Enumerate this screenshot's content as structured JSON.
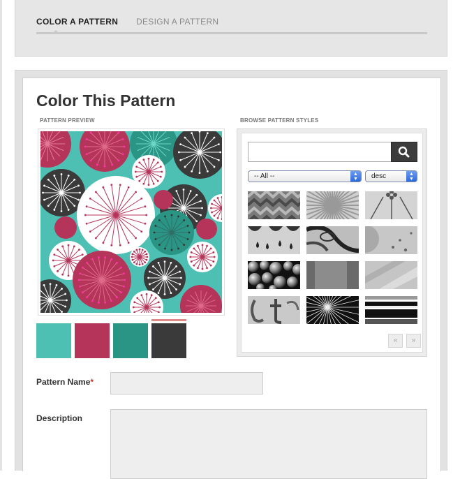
{
  "tabs": [
    {
      "label": "COLOR A PATTERN",
      "active": true
    },
    {
      "label": "DESIGN A PATTERN",
      "active": false
    }
  ],
  "page": {
    "title": "Color This Pattern"
  },
  "preview": {
    "label": "PATTERN PREVIEW"
  },
  "palette": {
    "swatches": [
      "#4dbfb3",
      "#b5345a",
      "#2a9585",
      "#3a3a3a"
    ],
    "selected_index": 3
  },
  "browse": {
    "label": "BROWSE PATTERN STYLES",
    "search": {
      "value": "",
      "icon": "search-icon"
    },
    "filter": {
      "selected": "-- All --"
    },
    "sort": {
      "selected": "desc"
    },
    "thumbnails": [
      "zigzag-pattern",
      "sunburst-pattern",
      "flower-pattern",
      "drops-pattern",
      "swirl-pattern",
      "dots-pattern",
      "bubbles-pattern",
      "blocks-pattern",
      "stripes-pattern",
      "letters-pattern",
      "starburst-pattern",
      "bands-pattern"
    ],
    "pager": {
      "prev": "«",
      "next": "»"
    }
  },
  "form": {
    "name_label": "Pattern Name",
    "required_mark": "*",
    "name_value": "",
    "description_label": "Description",
    "description_value": ""
  }
}
